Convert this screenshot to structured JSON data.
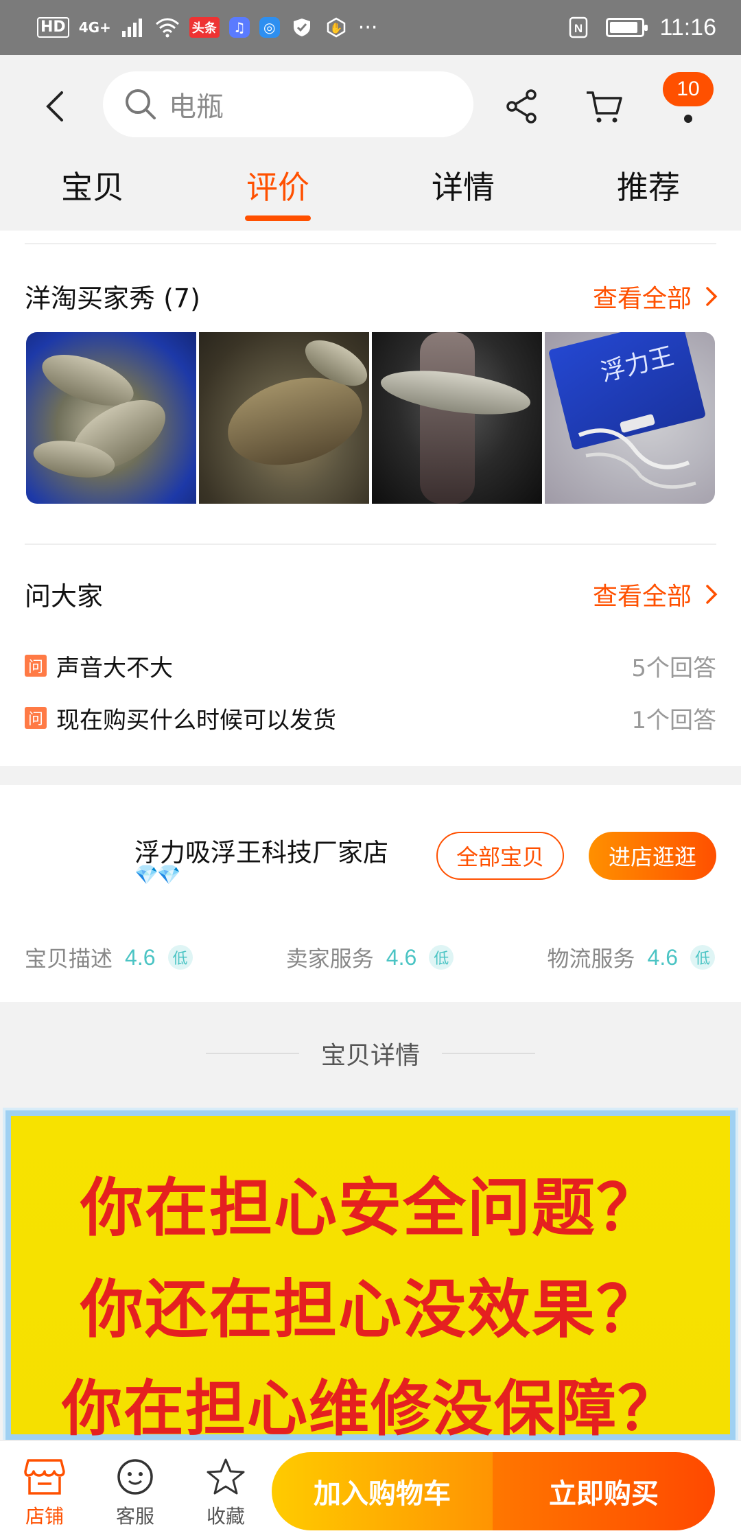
{
  "status_bar": {
    "hd": "HD",
    "network": "4G+",
    "app_badge": "头条",
    "more": "···",
    "time": "11:16",
    "battery_level": 0.9
  },
  "header": {
    "search_placeholder": "电瓶",
    "cart_count": "10"
  },
  "tabs": [
    {
      "label": "宝贝"
    },
    {
      "label": "评价"
    },
    {
      "label": "详情"
    },
    {
      "label": "推荐"
    }
  ],
  "buyer_show": {
    "title": "洋淘买家秀 (7)",
    "see_all": "查看全部",
    "photo4_text": "浮力王"
  },
  "ask": {
    "title": "问大家",
    "see_all": "查看全部",
    "tag": "问",
    "questions": [
      {
        "text": "声音大不大",
        "answers": "5个回答"
      },
      {
        "text": "现在购买什么时候可以发货",
        "answers": "1个回答"
      }
    ]
  },
  "store": {
    "name": "浮力吸浮王科技厂家店",
    "diamonds": "💎💎",
    "all_items": "全部宝贝",
    "enter_store": "进店逛逛",
    "ratings": [
      {
        "label": "宝贝描述",
        "value": "4.6",
        "level": "低"
      },
      {
        "label": "卖家服务",
        "value": "4.6",
        "level": "低"
      },
      {
        "label": "物流服务",
        "value": "4.6",
        "level": "低"
      }
    ]
  },
  "details": {
    "header": "宝贝详情",
    "banner_lines": [
      "你在担心安全问题？",
      "你还在担心没效果？",
      "你在担心维修没保障？"
    ]
  },
  "bottom_bar": {
    "shop": "店铺",
    "service": "客服",
    "favorite": "收藏",
    "add_to_cart": "加入购物车",
    "buy_now": "立即购买"
  },
  "colors": {
    "accent": "#ff5000",
    "rating": "#4bc4c4",
    "banner_bg": "#f5e000",
    "banner_text": "#e52020"
  }
}
